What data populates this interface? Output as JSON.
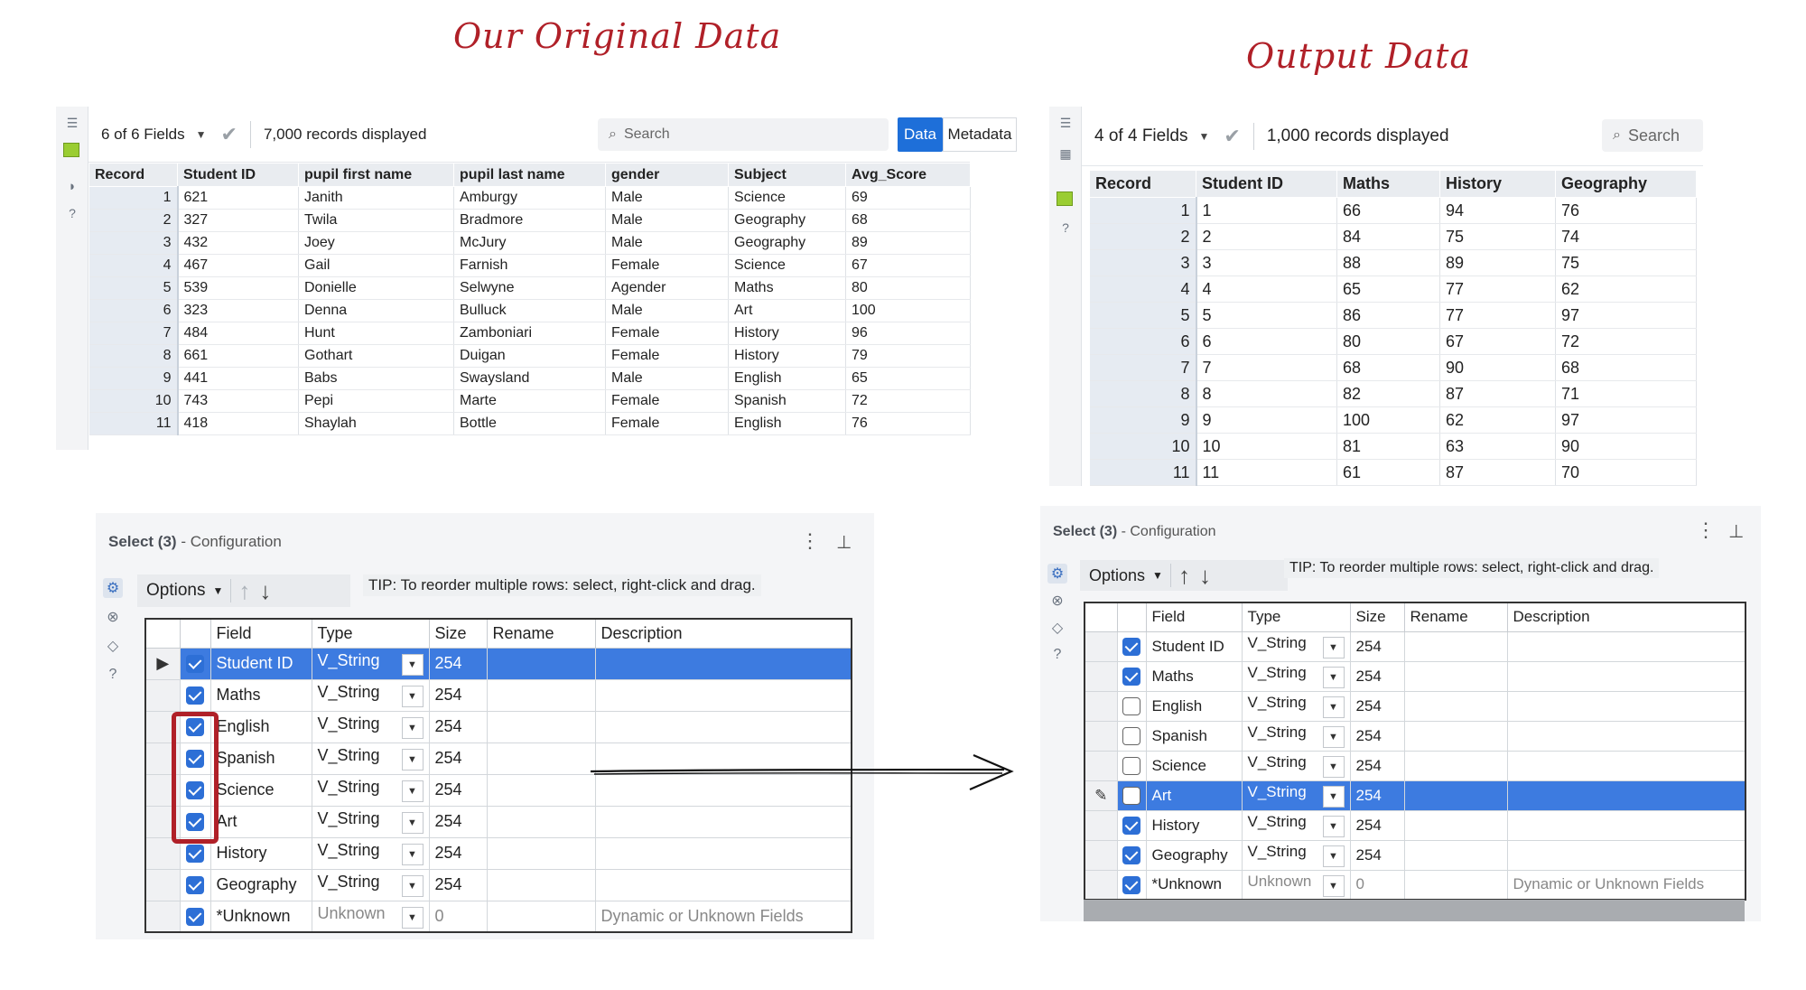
{
  "headings": {
    "original": "Our Original Data",
    "output": "Output Data"
  },
  "original_results": {
    "fields_label": "6 of 6 Fields",
    "records_label": "7,000 records displayed",
    "search_placeholder": "Search",
    "data_button": "Data",
    "metadata_button": "Metadata",
    "columns": [
      "Record",
      "Student ID",
      "pupil first name",
      "pupil last name",
      "gender",
      "Subject",
      "Avg_Score"
    ],
    "rows": [
      [
        "1",
        "621",
        "Janith",
        "Amburgy",
        "Male",
        "Science",
        "69"
      ],
      [
        "2",
        "327",
        "Twila",
        "Bradmore",
        "Male",
        "Geography",
        "68"
      ],
      [
        "3",
        "432",
        "Joey",
        "McJury",
        "Male",
        "Geography",
        "89"
      ],
      [
        "4",
        "467",
        "Gail",
        "Farnish",
        "Female",
        "Science",
        "67"
      ],
      [
        "5",
        "539",
        "Donielle",
        "Selwyne",
        "Agender",
        "Maths",
        "80"
      ],
      [
        "6",
        "323",
        "Denna",
        "Bulluck",
        "Male",
        "Art",
        "100"
      ],
      [
        "7",
        "484",
        "Hunt",
        "Zamboniari",
        "Female",
        "History",
        "96"
      ],
      [
        "8",
        "661",
        "Gothart",
        "Duigan",
        "Female",
        "History",
        "79"
      ],
      [
        "9",
        "441",
        "Babs",
        "Swaysland",
        "Male",
        "English",
        "65"
      ],
      [
        "10",
        "743",
        "Pepi",
        "Marte",
        "Female",
        "Spanish",
        "72"
      ],
      [
        "11",
        "418",
        "Shaylah",
        "Bottle",
        "Female",
        "English",
        "76"
      ]
    ]
  },
  "output_results": {
    "fields_label": "4 of 4 Fields",
    "records_label": "1,000 records displayed",
    "search_placeholder": "Search",
    "columns": [
      "Record",
      "Student ID",
      "Maths",
      "History",
      "Geography"
    ],
    "rows": [
      [
        "1",
        "1",
        "66",
        "94",
        "76"
      ],
      [
        "2",
        "2",
        "84",
        "75",
        "74"
      ],
      [
        "3",
        "3",
        "88",
        "89",
        "75"
      ],
      [
        "4",
        "4",
        "65",
        "77",
        "62"
      ],
      [
        "5",
        "5",
        "86",
        "77",
        "97"
      ],
      [
        "6",
        "6",
        "80",
        "67",
        "72"
      ],
      [
        "7",
        "7",
        "68",
        "90",
        "68"
      ],
      [
        "8",
        "8",
        "82",
        "87",
        "71"
      ],
      [
        "9",
        "9",
        "100",
        "62",
        "97"
      ],
      [
        "10",
        "10",
        "81",
        "63",
        "90"
      ],
      [
        "11",
        "11",
        "61",
        "87",
        "70"
      ]
    ]
  },
  "left_config": {
    "title_bold": "Select (3)",
    "title_rest": " - Configuration",
    "options_label": "Options",
    "tip": "TIP: To reorder multiple rows: select, right-click and drag.",
    "columns": [
      "Field",
      "Type",
      "Size",
      "Rename",
      "Description"
    ],
    "rows": [
      {
        "pointer": "▶",
        "checked": true,
        "field": "Student ID",
        "type": "V_String",
        "size": "254",
        "rename": "",
        "description": "",
        "selected": true
      },
      {
        "pointer": "",
        "checked": true,
        "field": "Maths",
        "type": "V_String",
        "size": "254",
        "rename": "",
        "description": ""
      },
      {
        "pointer": "",
        "checked": true,
        "field": "English",
        "type": "V_String",
        "size": "254",
        "rename": "",
        "description": ""
      },
      {
        "pointer": "",
        "checked": true,
        "field": "Spanish",
        "type": "V_String",
        "size": "254",
        "rename": "",
        "description": ""
      },
      {
        "pointer": "",
        "checked": true,
        "field": "Science",
        "type": "V_String",
        "size": "254",
        "rename": "",
        "description": ""
      },
      {
        "pointer": "",
        "checked": true,
        "field": "Art",
        "type": "V_String",
        "size": "254",
        "rename": "",
        "description": ""
      },
      {
        "pointer": "",
        "checked": true,
        "field": "History",
        "type": "V_String",
        "size": "254",
        "rename": "",
        "description": ""
      },
      {
        "pointer": "",
        "checked": true,
        "field": "Geography",
        "type": "V_String",
        "size": "254",
        "rename": "",
        "description": ""
      },
      {
        "pointer": "",
        "checked": true,
        "field": "*Unknown",
        "type": "Unknown",
        "size": "0",
        "rename": "",
        "description": "Dynamic or Unknown Fields",
        "muted": true
      }
    ]
  },
  "right_config": {
    "title_bold": "Select (3)",
    "title_rest": " - Configuration",
    "options_label": "Options",
    "tip": "TIP: To reorder multiple rows: select, right-click and drag.",
    "columns": [
      "Field",
      "Type",
      "Size",
      "Rename",
      "Description"
    ],
    "rows": [
      {
        "pointer": "",
        "checked": true,
        "field": "Student ID",
        "type": "V_String",
        "size": "254",
        "rename": "",
        "description": ""
      },
      {
        "pointer": "",
        "checked": true,
        "field": "Maths",
        "type": "V_String",
        "size": "254",
        "rename": "",
        "description": ""
      },
      {
        "pointer": "",
        "checked": false,
        "field": "English",
        "type": "V_String",
        "size": "254",
        "rename": "",
        "description": ""
      },
      {
        "pointer": "",
        "checked": false,
        "field": "Spanish",
        "type": "V_String",
        "size": "254",
        "rename": "",
        "description": ""
      },
      {
        "pointer": "",
        "checked": false,
        "field": "Science",
        "type": "V_String",
        "size": "254",
        "rename": "",
        "description": ""
      },
      {
        "pointer": "✎",
        "checked": false,
        "field": "Art",
        "type": "V_String",
        "size": "254",
        "rename": "",
        "description": "",
        "selected": true
      },
      {
        "pointer": "",
        "checked": true,
        "field": "History",
        "type": "V_String",
        "size": "254",
        "rename": "",
        "description": ""
      },
      {
        "pointer": "",
        "checked": true,
        "field": "Geography",
        "type": "V_String",
        "size": "254",
        "rename": "",
        "description": ""
      },
      {
        "pointer": "",
        "checked": true,
        "field": "*Unknown",
        "type": "Unknown",
        "size": "0",
        "rename": "",
        "description": "Dynamic or Unknown Fields",
        "muted": true
      }
    ]
  },
  "colors": {
    "heading": "#b02028",
    "accent": "#1e6fd9",
    "selected_row": "#3d7be0",
    "annotation": "#b02028"
  },
  "icons": [
    "list-icon",
    "table-icon",
    "tag-icon",
    "help-icon",
    "check-icon",
    "search-icon",
    "gear-icon",
    "pin-icon",
    "more-icon",
    "arrow-up-icon",
    "arrow-down-icon",
    "caret-down-icon"
  ]
}
